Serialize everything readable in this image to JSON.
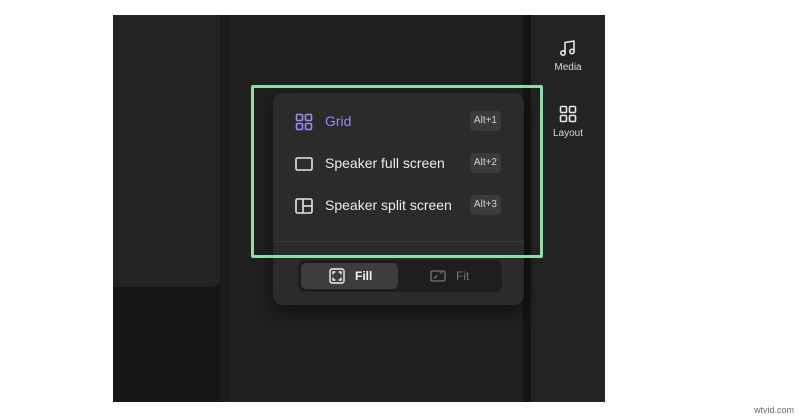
{
  "rail": {
    "media_label": "Media",
    "layout_label": "Layout"
  },
  "layout_menu": {
    "options": [
      {
        "label": "Grid",
        "shortcut": "Alt+1",
        "icon": "grid-icon",
        "active": true
      },
      {
        "label": "Speaker full screen",
        "shortcut": "Alt+2",
        "icon": "full-screen-icon",
        "active": false
      },
      {
        "label": "Speaker split screen",
        "shortcut": "Alt+3",
        "icon": "split-screen-icon",
        "active": false
      }
    ],
    "fit_toggle": {
      "fill_label": "Fill",
      "fit_label": "Fit",
      "selected": "Fill"
    }
  },
  "colors": {
    "accent": "#9f88ee",
    "highlight_frame": "#8fdcaa"
  },
  "watermark": "wtvid.com"
}
